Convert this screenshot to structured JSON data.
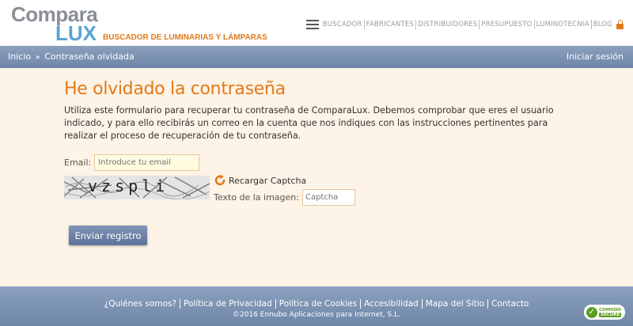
{
  "brand": {
    "logo_top": "Compara",
    "logo_bottom": "LUX",
    "tagline": "BUSCADOR DE LUMINARIAS Y LÁMPARAS"
  },
  "topnav": {
    "items": [
      "BUSCADOR",
      "FABRICANTES",
      "DISTRIBUIDORES",
      "PRESUPUESTO",
      "LUMINOTECNIA",
      "BLOG"
    ]
  },
  "breadcrumb": {
    "home": "Inicio",
    "separator": "»",
    "current": "Contraseña olvidada",
    "login": "Iniciar sesión"
  },
  "main": {
    "title": "He olvidado la contraseña",
    "intro": "Utiliza este formulario para recuperar tu contraseña de ComparaLux. Debemos comprobar que eres el usuario indicado, y para ello recibirás un correo en la cuenta que nos indiques con las instrucciones pertinentes para realizar el proceso de recuperación de tu contraseña.",
    "email_label": "Email:",
    "email_placeholder": "Introduce tu email",
    "captcha_text": "vzspli",
    "reload_label": "Recargar Captcha",
    "captcha_label": "Texto de la imagen:",
    "captcha_placeholder": "Captcha",
    "submit_label": "Enviar registro"
  },
  "footer": {
    "links": [
      "¿Quiénes somos?",
      "Política de Privacidad",
      "Política de Cookies",
      "Accesibilidad",
      "Mapa del Sitio",
      "Contacto"
    ],
    "copyright": "©2016 Ennubo Aplicaciones para Internet, S.L.",
    "badge_top": "COMODO",
    "badge_bottom": "SECURE"
  },
  "colors": {
    "accent": "#e07a1a",
    "bar": "#7a90b2",
    "background": "#fdf3e6"
  }
}
